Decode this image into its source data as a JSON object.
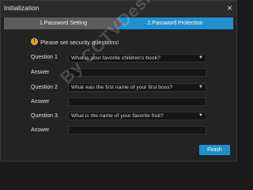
{
  "window": {
    "title": "Initialization",
    "close_icon": "close-icon"
  },
  "steps": [
    {
      "label": "1.Password Setting"
    },
    {
      "label": "2.Password Protection"
    }
  ],
  "notice": {
    "text": "Please set security questions!",
    "icon": "warning-icon"
  },
  "questions": [
    {
      "label": "Question 1",
      "value": "What is your favorite children's book?"
    },
    {
      "label": "Question 2",
      "value": "What was the first name of your first boss?"
    },
    {
      "label": "Question 3",
      "value": "What is the name of your favorite fruit?"
    }
  ],
  "answer_label": "Answer",
  "finish_label": "Finish",
  "watermark": "By CCTVDesk",
  "colors": {
    "accent": "#1e90cf",
    "warning": "#e6a23c",
    "background": "#232323"
  }
}
